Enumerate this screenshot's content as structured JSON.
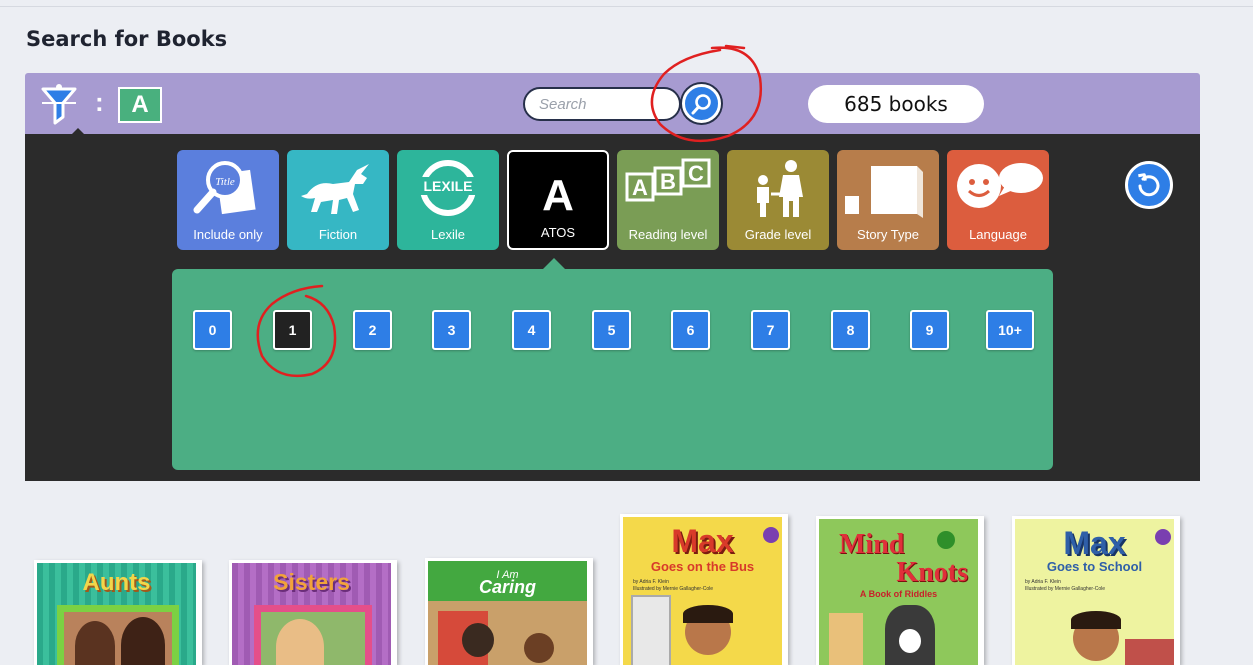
{
  "page": {
    "title": "Search for Books"
  },
  "topbar": {
    "filter_icon": "filter-funnel-icon",
    "separator": ":",
    "active_filter_letter": "A",
    "search_placeholder": "Search",
    "search_icon": "magnifier-icon",
    "book_count": "685 books"
  },
  "filter_tiles": [
    {
      "label": "Include only",
      "icon": "title-magnifier-icon",
      "color": "#5b7fdd"
    },
    {
      "label": "Fiction",
      "icon": "unicorn-icon",
      "color": "#36b7c4"
    },
    {
      "label": "Lexile",
      "icon": "lexile-logo-icon",
      "badge": "LEXILE",
      "color": "#2db59b"
    },
    {
      "label": "ATOS",
      "icon": "letter-a-icon",
      "glyph": "A",
      "color": "#000000",
      "selected": true
    },
    {
      "label": "Reading level",
      "icon": "abc-blocks-icon",
      "glyph": "ABC",
      "color": "#7a9d55"
    },
    {
      "label": "Grade level",
      "icon": "grade-figures-icon",
      "color": "#9b8a35"
    },
    {
      "label": "Story Type",
      "icon": "book-sizes-icon",
      "color": "#b77d4b"
    },
    {
      "label": "Language",
      "icon": "smiley-speech-icon",
      "color": "#dc5d3e"
    }
  ],
  "reset_icon": "reset-rotate-icon",
  "levels": [
    "0",
    "1",
    "2",
    "3",
    "4",
    "5",
    "6",
    "7",
    "8",
    "9",
    "10+"
  ],
  "selected_level": "1",
  "books": [
    {
      "title": "Aunts",
      "cover_color": "#2aa98a",
      "title_color": "#f2d64a"
    },
    {
      "title": "Sisters",
      "cover_color": "#a05bb3",
      "title_color": "#f2a33a"
    },
    {
      "title_small": "I Am",
      "title": "Caring",
      "cover_color": "#43a840",
      "title_color": "#ffffff"
    },
    {
      "title": "Max",
      "subtitle": "Goes on the Bus",
      "author": "by Adria F. Klein",
      "illustrator": "Illustrated by Mernie Gallagher-Cole",
      "cover_color": "#f4d94a",
      "title_color": "#d83a2a"
    },
    {
      "title": "Mind",
      "title2": "Knots",
      "subtitle": "A Book of Riddles",
      "cover_color": "#8ec85b",
      "title_color": "#e0303a"
    },
    {
      "title": "Max",
      "subtitle": "Goes to School",
      "author": "by Adria F. Klein",
      "illustrator": "Illustrated by Mernie Gallagher-Cole",
      "cover_color": "#eef3a0",
      "title_color": "#2f5fa8"
    }
  ]
}
